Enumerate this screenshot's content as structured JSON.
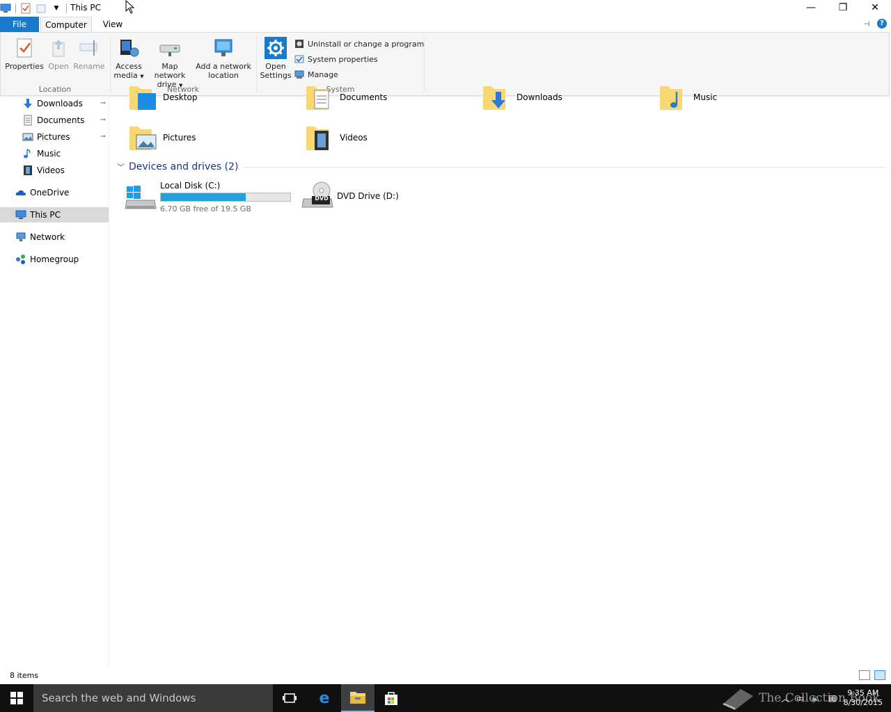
{
  "window": {
    "title": "This PC",
    "controls": {
      "minimize": "—",
      "restore": "❐",
      "close": "✕"
    }
  },
  "tabs": {
    "file": "File",
    "computer": "Computer",
    "view": "View"
  },
  "ribbon": {
    "location": {
      "label": "Location",
      "properties": "Properties",
      "open": "Open",
      "rename": "Rename"
    },
    "network": {
      "label": "Network",
      "access_media_1": "Access",
      "access_media_2": "media",
      "map_drive_1": "Map network",
      "map_drive_2": "drive",
      "add_location_1": "Add a network",
      "add_location_2": "location"
    },
    "system": {
      "label": "System",
      "open_settings_1": "Open",
      "open_settings_2": "Settings",
      "uninstall": "Uninstall or change a program",
      "system_properties": "System properties",
      "manage": "Manage"
    }
  },
  "nav": {
    "items": [
      {
        "label": "Downloads",
        "pinned": "📌"
      },
      {
        "label": "Documents",
        "pinned": "📌"
      },
      {
        "label": "Pictures",
        "pinned": "📌"
      },
      {
        "label": "Music"
      },
      {
        "label": "Videos"
      },
      {
        "label": "OneDrive"
      },
      {
        "label": "This PC"
      },
      {
        "label": "Network"
      },
      {
        "label": "Homegroup"
      }
    ]
  },
  "folders": [
    "Desktop",
    "Documents",
    "Downloads",
    "Music",
    "Pictures",
    "Videos"
  ],
  "devices": {
    "header": "Devices and drives (2)",
    "local_disk": {
      "name": "Local Disk (C:)",
      "free": "6.70 GB free of 19.5 GB",
      "used_fraction": 0.656
    },
    "dvd": {
      "name": "DVD Drive (D:)",
      "badge": "DVD"
    }
  },
  "status": {
    "items": "8 items"
  },
  "taskbar": {
    "search_placeholder": "Search the web and Windows",
    "time": "9:35 AM",
    "date": "8/30/2015",
    "watermark": "The Collection Book"
  },
  "colors": {
    "accent": "#1979ca",
    "drive_bar": "#26a0da",
    "section_header": "#1e3287"
  }
}
